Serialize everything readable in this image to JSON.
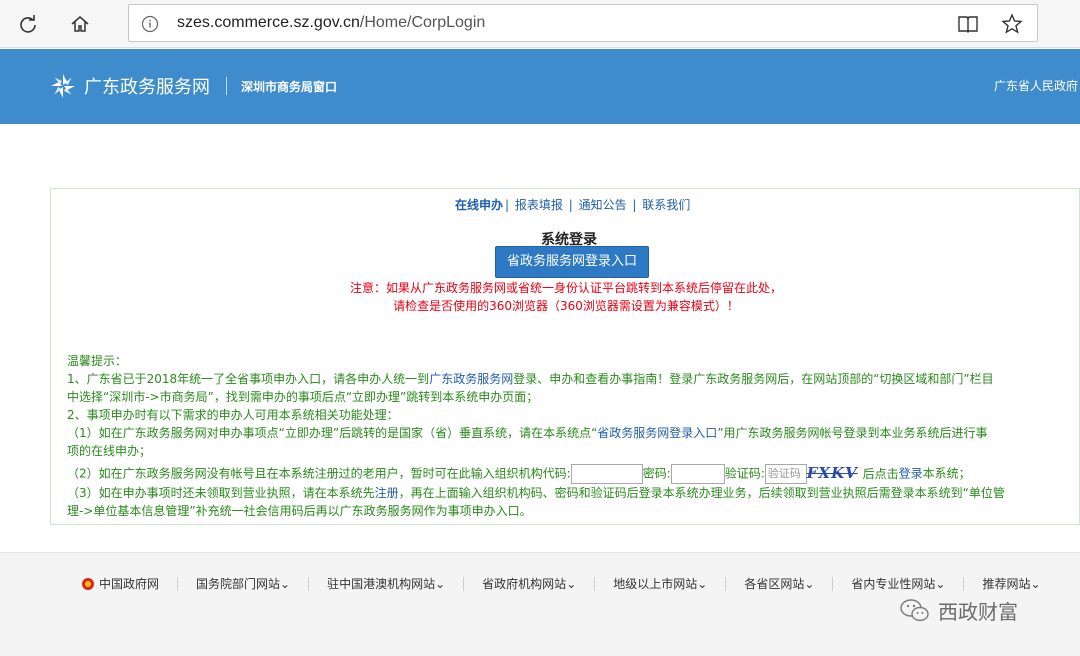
{
  "browser": {
    "url_host": "szes.commerce.sz.gov.cn",
    "url_path": "/Home/CorpLogin",
    "icons": [
      "refresh-icon",
      "home-icon",
      "info-icon",
      "reading-view-icon",
      "favorite-star-icon"
    ]
  },
  "header": {
    "site_name": "广东政务服务网",
    "sub_name": "深圳市商务局窗口",
    "right_text": "广东省人民政府"
  },
  "panel": {
    "top_links": [
      "在线申办",
      "报表填报",
      "通知公告",
      "联系我们"
    ],
    "login_title": "系统登录",
    "login_button": "省政务服务网登录入口",
    "notice_line1": "注意：如果从广东政务服务网或省统一身份认证平台跳转到本系统后停留在此处，",
    "notice_line2": "请检查是否使用的360浏览器（360浏览器需设置为兼容模式）！",
    "tips": {
      "heading": "温馨提示：",
      "p1_a": "1、广东省已于2018年统一了全省事项申办入口，请各申办人统一到",
      "p1_link": "广东政务服务网",
      "p1_b": "登录、申办和查看办事指南！登录广东政务服务网后，在网站顶部的“切换区域和部门”栏目",
      "p1_c": "中选择“深圳市->市商务局”，找到需申办的事项后点“立即办理”跳转到本系统申办页面；",
      "p2": "2、事项申办时有以下需求的申办人可用本系统相关功能处理：",
      "p3_a": "（1）如在广东政务服务网对申办事项点“立即办理”后跳转的是国家（省）垂直系统，请在本系统点“",
      "p3_link": "省政务服务网登录入口",
      "p3_b": "”用广东政务服务网帐号登录到本业务系统后进行事",
      "p3_c": "项的在线申办；",
      "p4_a": "（2）如在广东政务服务网没有帐号且在本系统注册过的老用户，暂时可在此输入组织机构代码:",
      "p4_pwd": "密码:",
      "p4_code": "验证码:",
      "captcha_placeholder": "验证码",
      "captcha_text": "FXKV",
      "p4_b": "后点击",
      "p4_login": "登录",
      "p4_c": "本系统；",
      "p5_a": "（3）如在申办事项时还未领取到营业执照，请在本系统先",
      "p5_link": "注册",
      "p5_b": "，再在上面输入组织机构码、密码和验证码后登录本系统办理业务，后续领取到营业执照后需登录本系统到“单位管",
      "p5_c": "理->单位基本信息管理”补充统一社会信用码后再以广东政务服务网作为事项申办入口。"
    }
  },
  "footer": {
    "items": [
      "中国政府网",
      "国务院部门网站",
      "驻中国港澳机构网站",
      "省政府机构网站",
      "地级以上市网站",
      "各省区网站",
      "省内专业性网站",
      "推荐网站"
    ],
    "watermark": "西政财富"
  }
}
